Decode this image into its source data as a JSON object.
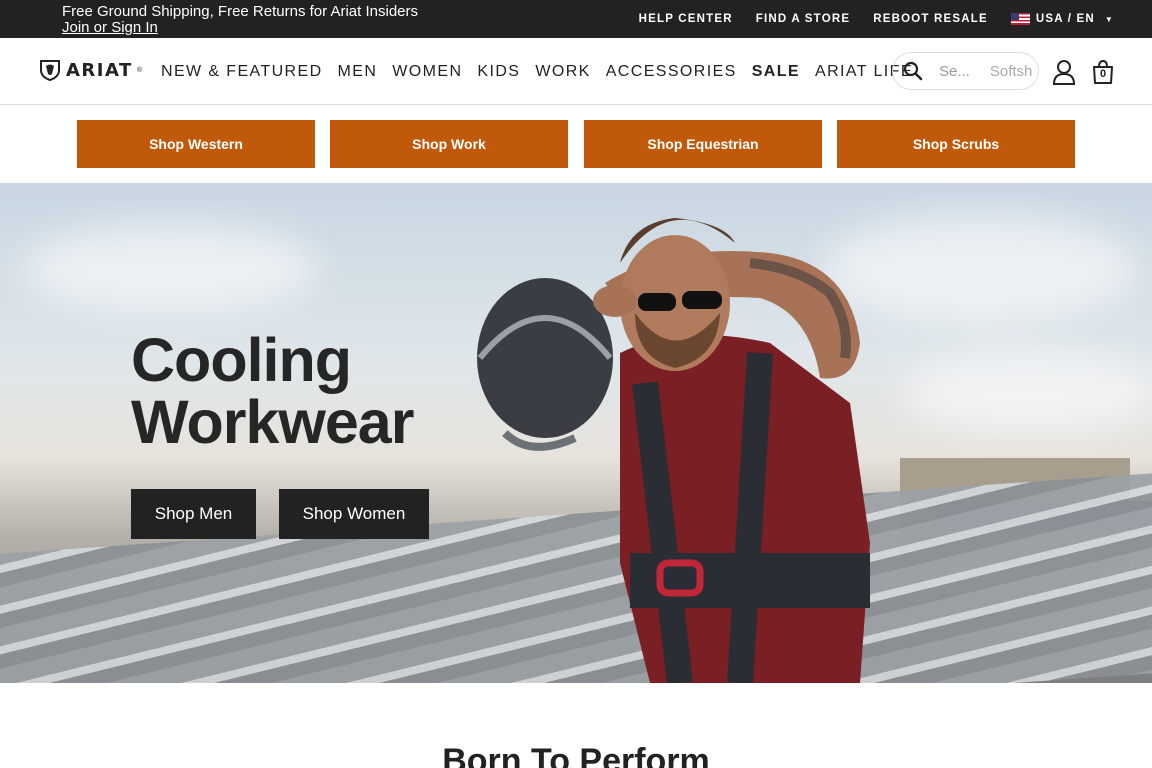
{
  "topbar": {
    "promo_line1": "Free Ground Shipping, Free Returns for Ariat Insiders",
    "promo_line2": "Join or Sign In",
    "links": [
      "HELP CENTER",
      "FIND A STORE",
      "REBOOT RESALE"
    ],
    "locale": "USA / EN"
  },
  "nav": {
    "logo": "ARIAT",
    "items": [
      "NEW & FEATURED",
      "MEN",
      "WOMEN",
      "KIDS",
      "WORK",
      "ACCESSORIES",
      "SALE",
      "ARIAT LIFE"
    ],
    "search_placeholder": "Se...",
    "search_suggestion": "Softsh",
    "bag_count": "0"
  },
  "categories": [
    "Shop Western",
    "Shop Work",
    "Shop Equestrian",
    "Shop Scrubs"
  ],
  "hero": {
    "title_line1": "Cooling",
    "title_line2": "Workwear",
    "btn_men": "Shop Men",
    "btn_women": "Shop Women"
  },
  "section": {
    "title": "Born To Perform"
  },
  "colors": {
    "topbar_bg": "#222222",
    "category_bg": "#c05a0a",
    "hero_button_bg": "#222222"
  }
}
